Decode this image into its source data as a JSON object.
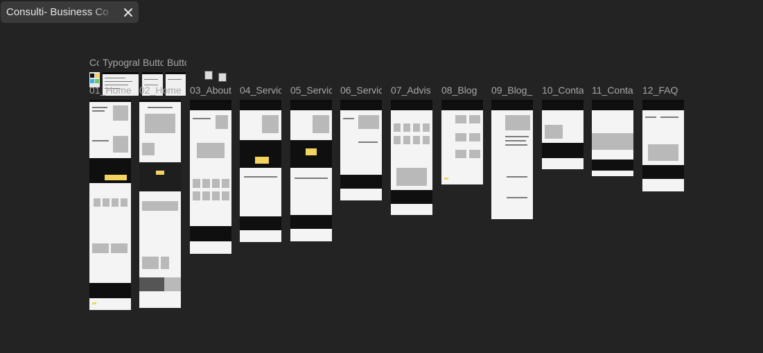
{
  "tab": {
    "title": "Consulti- Business Co",
    "close_icon": "close-icon"
  },
  "top_labels": [
    "Co",
    "Typogral",
    "Butto",
    "Butto"
  ],
  "frame_labels": [
    "01_Home",
    "02_Home",
    "03_About",
    "04_Servic",
    "05_Servic",
    "06_Servic",
    "07_Advis",
    "08_Blog",
    "09_Blog_",
    "10_Conta",
    "11_Conta",
    "12_FAQ"
  ],
  "colors": {
    "background": "#232323",
    "tab": "#3a3a3a",
    "accent_yellow": "#f4d35e",
    "frame_dark": "#0f0f0f"
  }
}
